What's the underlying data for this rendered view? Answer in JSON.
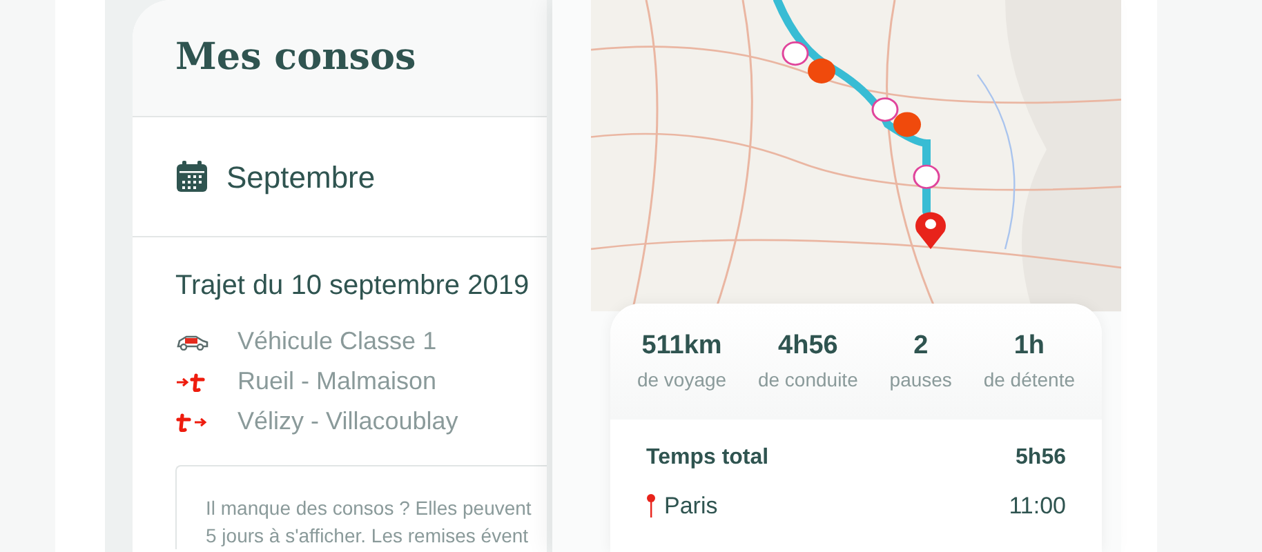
{
  "left_card": {
    "title": "Mes consos",
    "month": "Septembre",
    "trip": {
      "title": "Trajet du 10 septembre 2019",
      "details": [
        {
          "kind": "vehicle",
          "text": "Véhicule Classe 1"
        },
        {
          "kind": "entry",
          "text": "Rueil - Malmaison"
        },
        {
          "kind": "exit",
          "text": "Vélizy - Villacoublay"
        }
      ]
    },
    "notice": [
      "Il manque des consos ? Elles peuvent",
      "5 jours à s'afficher. Les remises évent"
    ]
  },
  "trip_panel": {
    "stats": [
      {
        "value": "511km",
        "label": "de voyage"
      },
      {
        "value": "4h56",
        "label": "de conduite"
      },
      {
        "value": "2",
        "label": "pauses"
      },
      {
        "value": "1h",
        "label": "de détente"
      }
    ],
    "total": {
      "label": "Temps total",
      "value": "5h56"
    },
    "stops": [
      {
        "name": "Paris",
        "time": "11:00"
      }
    ]
  }
}
